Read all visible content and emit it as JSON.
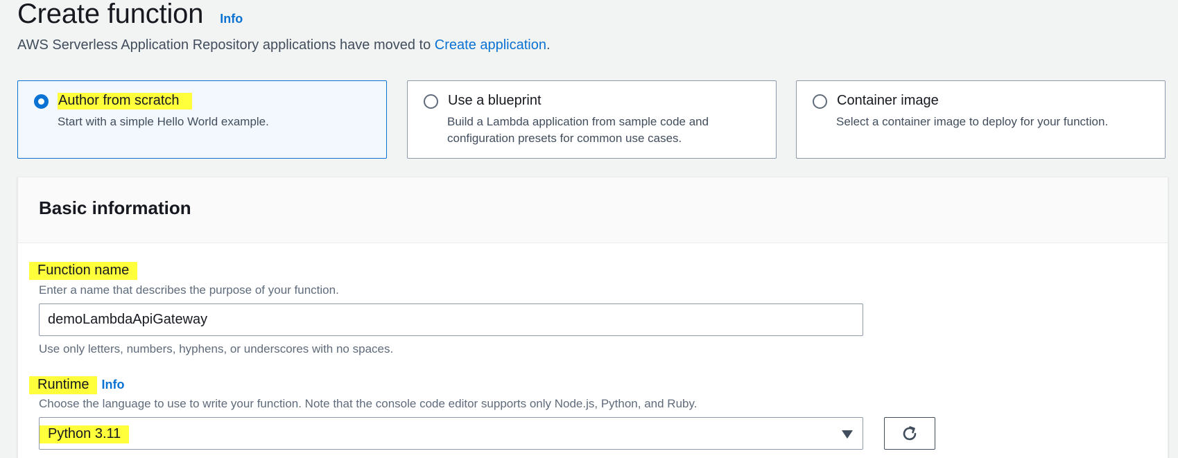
{
  "header": {
    "title": "Create function",
    "info_label": "Info",
    "notice_text": "AWS Serverless Application Repository applications have moved to ",
    "notice_link": "Create application",
    "notice_end": "."
  },
  "options": [
    {
      "title": "Author from scratch",
      "description": "Start with a simple Hello World example.",
      "selected": true
    },
    {
      "title": "Use a blueprint",
      "description": "Build a Lambda application from sample code and configuration presets for common use cases.",
      "selected": false
    },
    {
      "title": "Container image",
      "description": "Select a container image to deploy for your function.",
      "selected": false
    }
  ],
  "basic_info": {
    "title": "Basic information",
    "function_name": {
      "label": "Function name",
      "description": "Enter a name that describes the purpose of your function.",
      "value": "demoLambdaApiGateway",
      "constraint": "Use only letters, numbers, hyphens, or underscores with no spaces."
    },
    "runtime": {
      "label": "Runtime",
      "info_label": "Info",
      "description": "Choose the language to use to write your function. Note that the console code editor supports only Node.js, Python, and Ruby.",
      "value": "Python 3.11"
    }
  },
  "colors": {
    "accent": "#0972d3",
    "highlight": "#ffff3c",
    "page_background": "#f2f3f3"
  },
  "icons": {
    "dropdown": "caret-down-icon",
    "refresh": "refresh-icon"
  }
}
